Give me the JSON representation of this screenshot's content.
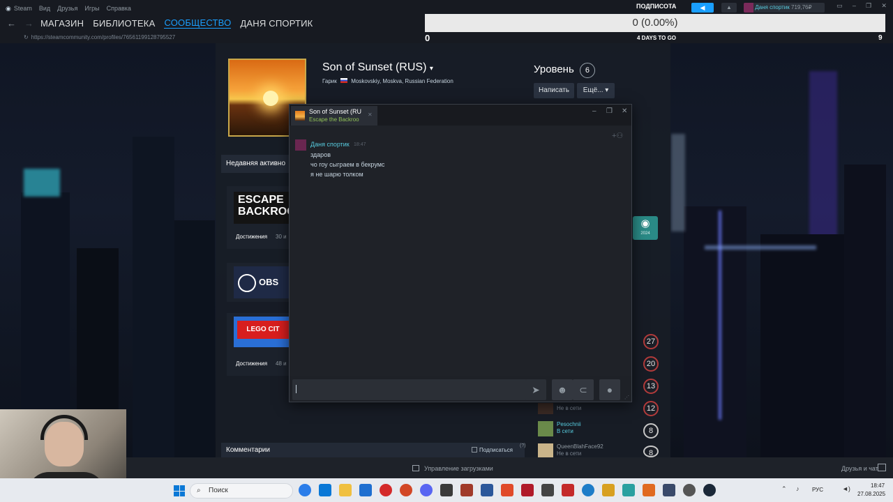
{
  "menubar": {
    "app": "Steam",
    "items": [
      "Вид",
      "Друзья",
      "Игры",
      "Справка"
    ],
    "username": "Даня спортик",
    "balance": "719,76₽"
  },
  "nav": {
    "items": [
      "МАГАЗИН",
      "БИБЛИОТЕКА",
      "СООБЩЕСТВО",
      "ДАНЯ СПОРТИК"
    ],
    "active": "СООБЩЕСТВО",
    "url": "https://steamcommunity.com/profiles/76561199128795527"
  },
  "overlay": {
    "label": "ПОДПИСОТА",
    "progress_text": "0 (0.00%)",
    "progress_fraction": 0,
    "min": "0",
    "max": "9",
    "days": "4 DAYS TO GO"
  },
  "profile": {
    "name": "Son of Sunset (RUS)",
    "real_name": "Гарик",
    "location": "Moskovskiy, Moskva, Russian Federation",
    "level_label": "Уровень",
    "level": "6",
    "write_button": "Написать",
    "more_button": "Ещё...",
    "recent_label": "Недавняя активно",
    "games": [
      {
        "title": "ESCAPE BACKROO",
        "footer": "Достижения",
        "count": "30 и"
      },
      {
        "title": "OBS St",
        "footer": "",
        "count": ""
      },
      {
        "title": "LEGO CIT",
        "footer": "Достижения",
        "count": "48 и"
      }
    ],
    "comments_label": "Комментарии",
    "subscribe_label": "Подписаться",
    "badge_year": "2024"
  },
  "chat": {
    "tab_title": "Son of Sunset (RU",
    "tab_subtitle": "Escape the Backroo",
    "sender": "Даня спортик",
    "time": "18:47",
    "messages": [
      "здаров",
      "чо гоу сыграем в бекрумс",
      "я не шарю толком"
    ],
    "input_value": ""
  },
  "friends": [
    {
      "name": "",
      "status": "Не в сети"
    },
    {
      "name": "Pesochnii",
      "status": "В сети"
    },
    {
      "name": "QueenBlahFace92",
      "status": "Не в сети"
    }
  ],
  "side_counts": [
    "27",
    "20",
    "13",
    "12",
    "8",
    "8"
  ],
  "downloads": {
    "label": "Управление загрузками",
    "friends_chat": "Друзья и чат"
  },
  "taskbar": {
    "search": "Поиск",
    "lang": "РУС",
    "time": "18:47",
    "date": "27.08.2025"
  },
  "colors": {
    "accent": "#1a9fff",
    "steam_bg": "#171a21",
    "online": "#57cbde",
    "badge_ring": "#b33b3b"
  }
}
